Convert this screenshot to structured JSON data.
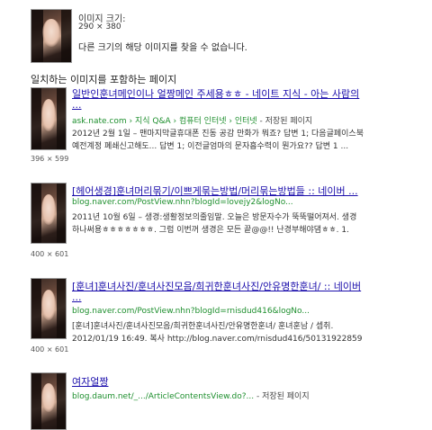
{
  "top": {
    "size_label": "이미지 크기:",
    "size_value": "290 × 380",
    "no_other_sizes": "다른 크기의 해당 이미지를 찾을 수 없습니다."
  },
  "section_title": "일치하는 이미지를 포함하는 페이지",
  "results": [
    {
      "title_line1": "일반인훈녀메인이나 얼짱메인 주세용ㅎㅎ - 네이트 지식 - 아는 사람의",
      "title_line2": "...",
      "url": "ask.nate.com › 지식 Q&A › 컴퓨터 인터넷 › 인터넷",
      "cached": " - 저장된 페이지",
      "snippet1": "2012년 2월 1일 – 맨마지막글휴대폰 진동 공감 만화가 뭐죠? 답변 1; 다음글페이스북",
      "snippet2": "예전계정 폐쇄신고해도... 답변 1; 이전글엄마의 문자흡수력이 뭔가요?? 답변 1 ...",
      "dims": "396 × 599"
    },
    {
      "title_line1": "[헤어생경]훈녀머리묶기/이쁘게묶는방법/머리묶는방법들 :: 네이버 ...",
      "url": "blog.naver.com/PostView.nhn?blogId=lovejy2&logNo...",
      "cached": "",
      "snippet1": "2011년 10월 6일 – 생경:생활정보의줄임말. 오늘은 방문자수가 뚝뚝떨어져서. 생경",
      "snippet2": "하나써용ㅎㅎㅎㅎㅎㅎㅎ. 그럼 이번꺼 생경은 모든 끝@@!! 난경부해야댐ㅎㅎ. 1.",
      "dims": "400 × 601"
    },
    {
      "title_line1": "[훈녀]훈녀사진/훈녀사진모음/희귀한훈녀사진/안유명한훈녀/ :: 네이버",
      "title_line2": "...",
      "url": "blog.naver.com/PostView.nhn?blogId=rnisdud416&logNo...",
      "cached": "",
      "snippet1": "[훈녀]훈녀사진/훈녀사진모음/희귀한훈녀사진/안유명한훈녀/ 훈녀훈남 / 셉취.",
      "snippet2": "2012/01/19 16:49. 복사 http://blog.naver.com/rnisdud416/50131922859",
      "dims": "400 × 601"
    },
    {
      "title_line1": "여자얼짱",
      "url": "blog.daum.net/_.../ArticleContentsView.do?...",
      "cached": " - 저장된 페이지"
    }
  ]
}
